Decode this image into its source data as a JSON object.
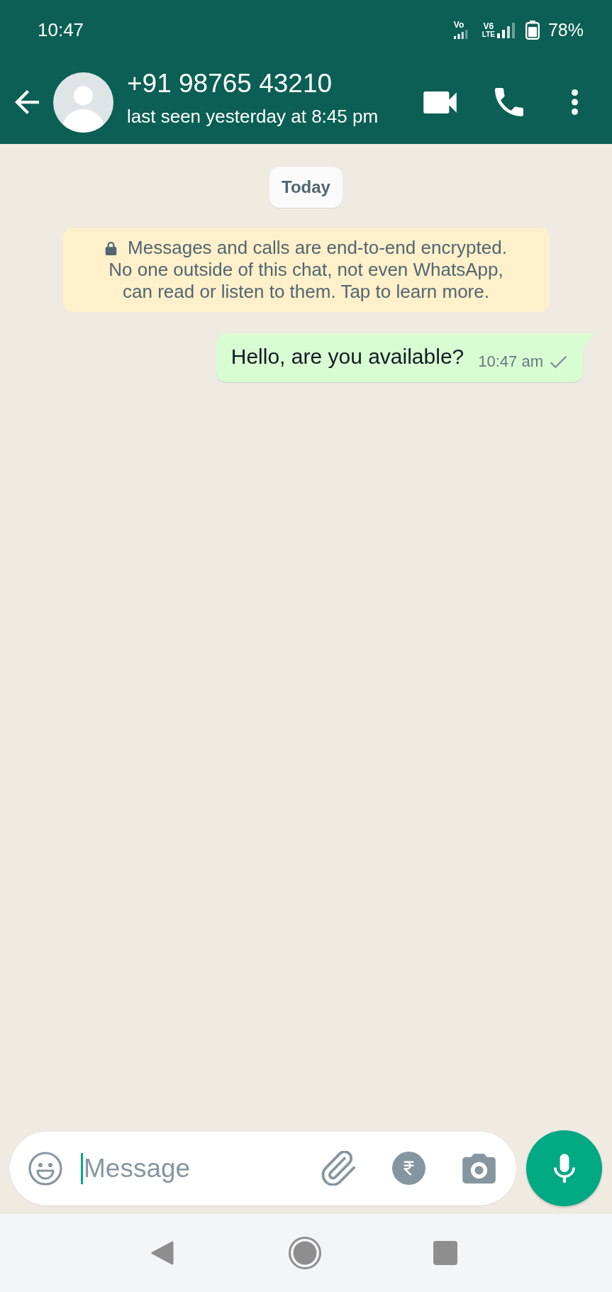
{
  "status_bar": {
    "time": "10:47",
    "network_indicators": [
      {
        "top": "Vo"
      },
      {
        "top": "V6",
        "bottom": "LTE"
      }
    ],
    "battery_percent": "78%"
  },
  "header": {
    "contact": "+91 98765 43210",
    "status": "last seen yesterday at 8:45 pm"
  },
  "chat": {
    "date_chip": "Today",
    "encryption_notice": {
      "heading": "Messages and calls are end-to-end encrypted.",
      "detail": "No one outside of this chat, not even WhatsApp, can read or listen to them. Tap to learn more."
    },
    "messages": [
      {
        "kind": "outgoing",
        "text": "Hello, are you available?",
        "time": "10:47 am",
        "delivered": false,
        "read": false
      }
    ]
  },
  "composer": {
    "placeholder": "Message"
  }
}
